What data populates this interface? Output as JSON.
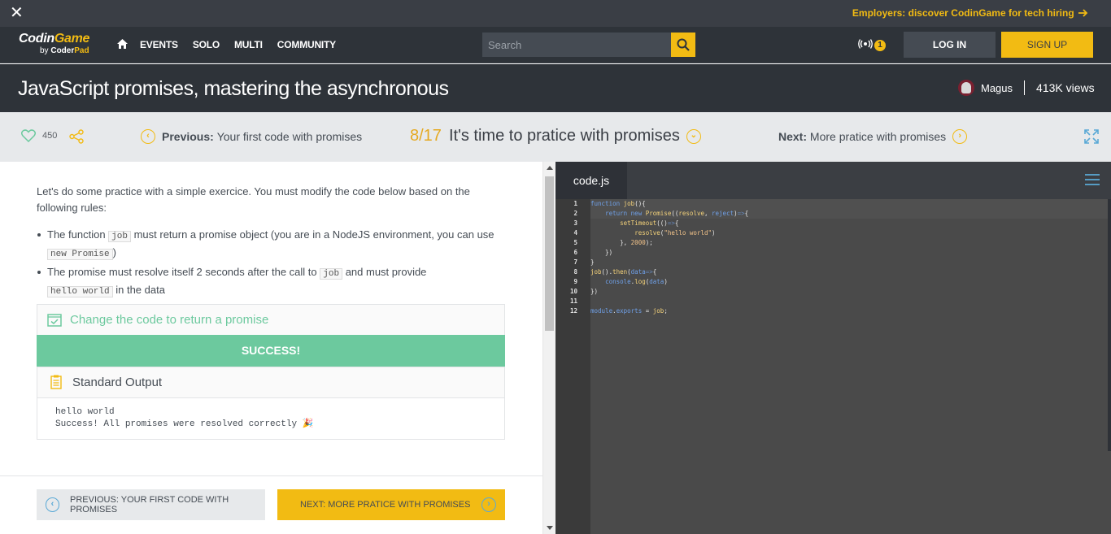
{
  "banner": {
    "close_label": "✕",
    "promo": "Employers: discover CodinGame for tech hiring"
  },
  "nav": {
    "logo_main_a": "Codin",
    "logo_main_b": "Game",
    "logo_sub_a": "by ",
    "logo_sub_b": "Coder",
    "logo_sub_c": "Pad",
    "links": [
      "EVENTS",
      "SOLO",
      "MULTI",
      "COMMUNITY"
    ],
    "search_placeholder": "Search",
    "notif_count": "1",
    "login": "LOG IN",
    "signup": "SIGN UP"
  },
  "header": {
    "title": "JavaScript promises, mastering the asynchronous",
    "author": "Magus",
    "views": "413K views"
  },
  "lesson": {
    "likes": "450",
    "prev_prefix": "Previous:",
    "prev_title": "Your first code with promises",
    "step_num": "8/17",
    "step_title": "It's time to pratice with promises",
    "next_prefix": "Next:",
    "next_title": "More pratice with promises"
  },
  "content": {
    "intro": "Let's do some practice with a simple exercice. You must modify the code below based on the following rules:",
    "rule1_a": "The function ",
    "rule1_code1": "job",
    "rule1_b": " must return a promise object (you are in a NodeJS environment, you can use ",
    "rule1_code2": "new Promise",
    "rule1_c": ")",
    "rule2_a": "The promise must resolve itself 2 seconds after the call to ",
    "rule2_code1": "job",
    "rule2_b": " and must provide ",
    "rule2_code2": "hello world",
    "rule2_c": " in the data",
    "task_label": "Change the code to return a promise",
    "success_label": "SUCCESS!",
    "stdout_label": "Standard Output",
    "stdout_line1": "hello world",
    "stdout_line2": "Success! All promises were resolved correctly 🎉",
    "btn_prev": "PREVIOUS: YOUR FIRST CODE WITH PROMISES",
    "btn_next": "NEXT: MORE PRATICE WITH PROMISES"
  },
  "editor": {
    "tab": "code.js",
    "line_numbers": [
      "1",
      "2",
      "3",
      "4",
      "5",
      "6",
      "7",
      "8",
      "9",
      "10",
      "11",
      "12"
    ]
  },
  "colors": {
    "accent": "#f2bb13",
    "success": "#6cc99e",
    "dark": "#2e3339"
  }
}
